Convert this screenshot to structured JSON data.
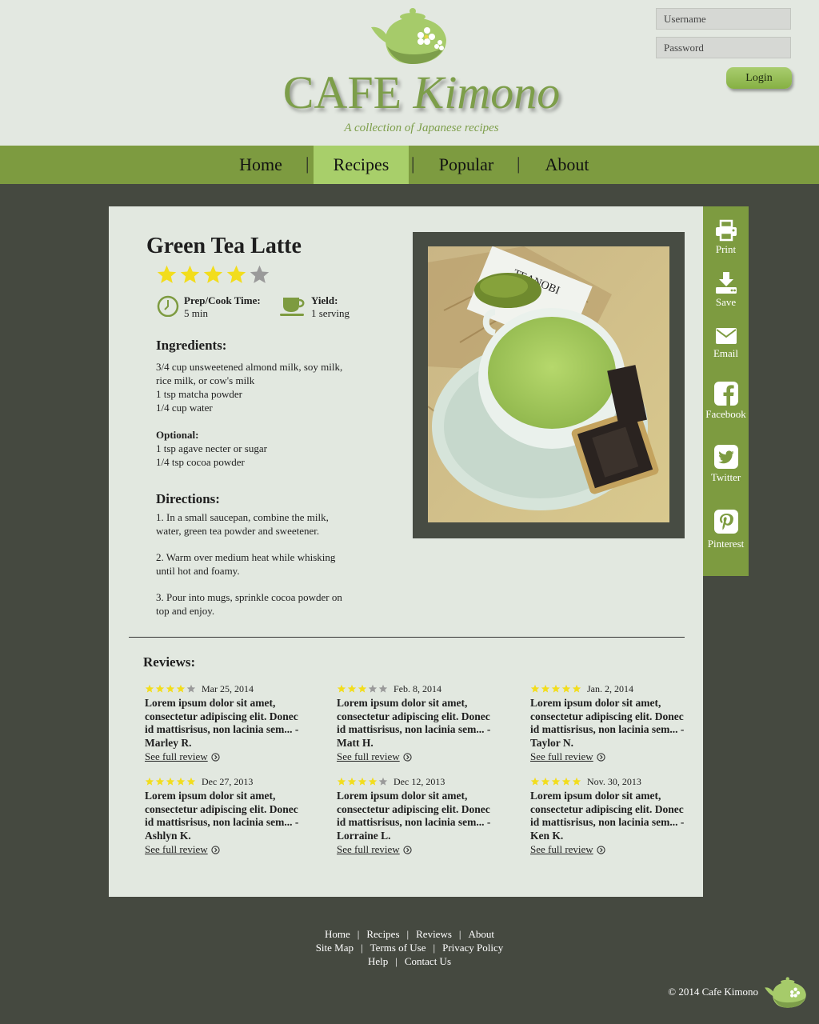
{
  "header": {
    "brand_cafe": "CAFE",
    "brand_kimono": "Kimono",
    "tagline": "A collection of Japanese recipes",
    "username_placeholder": "Username",
    "password_placeholder": "Password",
    "login_label": "Login"
  },
  "nav": {
    "items": [
      {
        "label": "Home"
      },
      {
        "label": "Recipes",
        "active": true
      },
      {
        "label": "Popular"
      },
      {
        "label": "About"
      }
    ],
    "separator": "|"
  },
  "recipe": {
    "title": "Green Tea Latte",
    "rating": 4,
    "rating_max": 5,
    "prep_label": "Prep/Cook Time:",
    "prep_value": "5 min",
    "yield_label": "Yield:",
    "yield_value": "1 serving",
    "ingredients_heading": "Ingredients:",
    "ingredients": [
      "3/4 cup unsweetened almond milk, soy milk, rice milk, or cow's milk",
      "1 tsp matcha powder",
      "1/4 cup water"
    ],
    "optional_label": "Optional:",
    "optional": [
      "1 tsp agave necter or sugar",
      "1/4 tsp cocoa powder"
    ],
    "directions_heading": "Directions:",
    "directions": [
      "1. In a small saucepan, combine the milk, water, green tea powder and sweetener.",
      "2. Warm over medium heat while whisking until hot and foamy.",
      "3. Pour into mugs, sprinkle cocoa powder on top and enjoy."
    ],
    "photo_card_text": "TEANOBI"
  },
  "reviews": {
    "heading": "Reviews:",
    "link_label": "See full review",
    "items": [
      {
        "stars": 4,
        "date": "Mar 25, 2014",
        "text": "Lorem ipsum dolor sit amet, consectetur adipiscing elit. Donec id mattisrisus, non lacinia sem...",
        "author": "-Marley R."
      },
      {
        "stars": 3,
        "date": "Feb. 8, 2014",
        "text": "Lorem ipsum dolor sit amet, consectetur adipiscing elit. Donec id mattisrisus, non lacinia sem...",
        "author": "-Matt H."
      },
      {
        "stars": 5,
        "date": "Jan. 2, 2014",
        "text": "Lorem ipsum dolor sit amet, consectetur adipiscing elit. Donec id mattisrisus, non lacinia sem...",
        "author": "-Taylor N."
      },
      {
        "stars": 5,
        "date": "Dec 27, 2013",
        "text": "Lorem ipsum dolor sit amet, consectetur adipiscing elit. Donec id mattisrisus, non lacinia sem...",
        "author": "-Ashlyn K."
      },
      {
        "stars": 4,
        "date": "Dec 12, 2013",
        "text": "Lorem ipsum dolor sit amet, consectetur adipiscing elit. Donec id mattisrisus, non lacinia sem...",
        "author": "-Lorraine L."
      },
      {
        "stars": 5,
        "date": "Nov. 30, 2013",
        "text": "Lorem ipsum dolor sit amet, consectetur adipiscing elit. Donec id mattisrisus, non lacinia sem...",
        "author": "-Ken K."
      }
    ]
  },
  "share": [
    {
      "label": "Print",
      "icon": "print-icon"
    },
    {
      "label": "Save",
      "icon": "save-icon"
    },
    {
      "label": "Email",
      "icon": "email-icon"
    },
    {
      "label": "Facebook",
      "icon": "facebook-icon"
    },
    {
      "label": "Twitter",
      "icon": "twitter-icon"
    },
    {
      "label": "Pinterest",
      "icon": "pinterest-icon"
    }
  ],
  "footer": {
    "rows": [
      [
        "Home",
        "Recipes",
        "Reviews",
        "About"
      ],
      [
        "Site Map",
        "Terms of Use",
        "Privacy Policy"
      ],
      [
        "Help",
        "Contact Us"
      ]
    ],
    "copyright": "© 2014 Cafe Kimono"
  },
  "colors": {
    "nav_green": "#7d9b40",
    "nav_active": "#a8cf6a",
    "header_bg": "#e3e8e1",
    "dark_bg": "#454940",
    "card_bg": "#e2e8e0",
    "star_gold": "#f2dd1d",
    "star_gray": "#9a9a9a"
  }
}
